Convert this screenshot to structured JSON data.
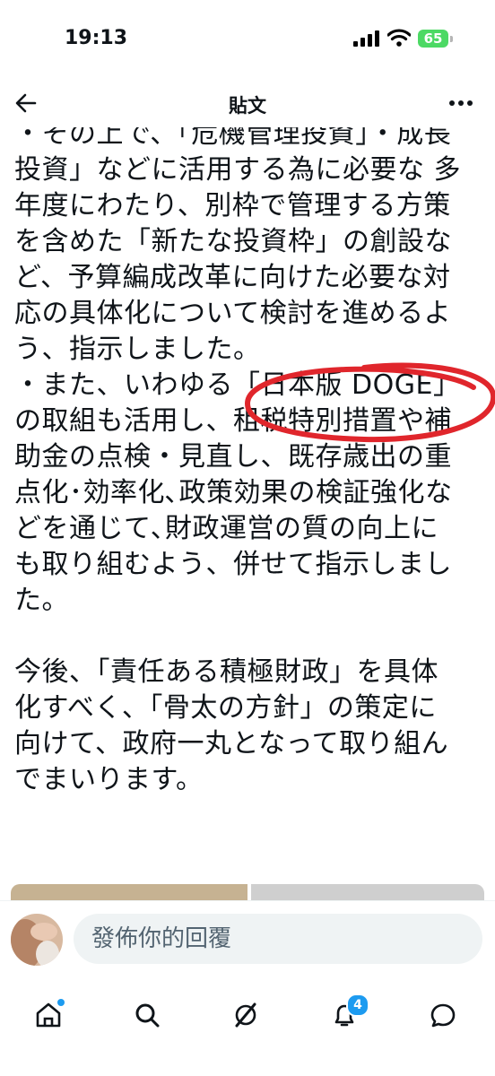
{
  "status_bar": {
    "time": "19:13",
    "battery": "65"
  },
  "header": {
    "title": "貼文"
  },
  "post": {
    "lines_top": [
      "・その上で、「危機管理投資」・成長",
      "投資」などに活用する為に必要な 多",
      "年度にわたり、別枠で管理する方策",
      "を含めた「新たな投資枠」の創設な",
      "ど、予算編成改革に向けた必要な対",
      "応の具体化について検討を進めるよ",
      "う、指示しました。",
      "・また、いわゆる「日本版 DOGE」",
      "の取組も活用し、租税特別措置や補",
      "助金の点検・見直し、既存歳出の重",
      "点化･効率化､政策効果の検証強化な",
      "どを通じて､財政運営の質の向上に",
      "も取り組むよう、併せて指示しまし",
      "た。"
    ],
    "lines_bottom": [
      "今後、「責任ある積極財政」を具体",
      "化すべく、「骨太の方針」の策定に",
      "向けて、政府一丸となって取り組ん",
      "でまいります。"
    ]
  },
  "reply": {
    "placeholder": "發佈你的回覆"
  },
  "tabs": {
    "notifications_badge": "4"
  },
  "colors": {
    "accent": "#1d9bf0",
    "annotation_red": "#e0262c",
    "battery": "#4cd964"
  }
}
